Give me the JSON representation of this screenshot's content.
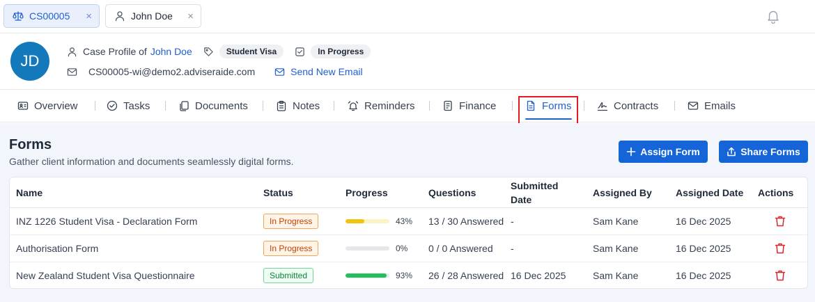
{
  "top_tabs": [
    {
      "label": "CS00005",
      "icon": "scale-icon",
      "active": true
    },
    {
      "label": "John Doe",
      "icon": "user-icon",
      "active": false
    }
  ],
  "profile": {
    "initials": "JD",
    "case_profile_prefix": "Case Profile of",
    "client_name": "John Doe",
    "visa_tag": "Student Visa",
    "status_tag": "In Progress",
    "email": "CS00005-wi@demo2.adviseraide.com",
    "send_email_label": "Send New Email"
  },
  "nav_tabs": [
    {
      "label": "Overview",
      "icon": "id-card-icon"
    },
    {
      "label": "Tasks",
      "icon": "check-circle-icon"
    },
    {
      "label": "Documents",
      "icon": "documents-icon"
    },
    {
      "label": "Notes",
      "icon": "clipboard-icon"
    },
    {
      "label": "Reminders",
      "icon": "alarm-icon"
    },
    {
      "label": "Finance",
      "icon": "ledger-icon"
    },
    {
      "label": "Forms",
      "icon": "form-icon",
      "active": true
    },
    {
      "label": "Contracts",
      "icon": "signature-icon"
    },
    {
      "label": "Emails",
      "icon": "mail-icon"
    }
  ],
  "forms": {
    "title": "Forms",
    "subtitle": "Gather client information and documents seamlessly digital forms.",
    "assign_label": "Assign Form",
    "share_label": "Share Forms",
    "columns": {
      "name": "Name",
      "status": "Status",
      "progress": "Progress",
      "questions": "Questions",
      "submitted_line1": "Submitted",
      "submitted_line2": "Date",
      "assigned_by": "Assigned By",
      "assigned_date": "Assigned Date",
      "actions": "Actions"
    },
    "rows": [
      {
        "name": "INZ 1226 Student Visa - Declaration Form",
        "status": "In Progress",
        "progress": 43,
        "progress_label": "43%",
        "questions": "13 / 30 Answered",
        "submitted_date": "-",
        "assigned_by": "Sam Kane",
        "assigned_date": "16 Dec 2025"
      },
      {
        "name": "Authorisation Form",
        "status": "In Progress",
        "progress": 0,
        "progress_label": "0%",
        "questions": "0 / 0 Answered",
        "submitted_date": "-",
        "assigned_by": "Sam Kane",
        "assigned_date": "16 Dec 2025"
      },
      {
        "name": "New Zealand Student Visa Questionnaire",
        "status": "Submitted",
        "progress": 93,
        "progress_label": "93%",
        "questions": "26 / 28 Answered",
        "submitted_date": "16 Dec 2025",
        "assigned_by": "Sam Kane",
        "assigned_date": "16 Dec 2025"
      }
    ]
  },
  "colors": {
    "accent": "#1565d8",
    "progress_yellow": "#f2c40f",
    "progress_green": "#22c05a",
    "delete_red": "#e0242b"
  }
}
